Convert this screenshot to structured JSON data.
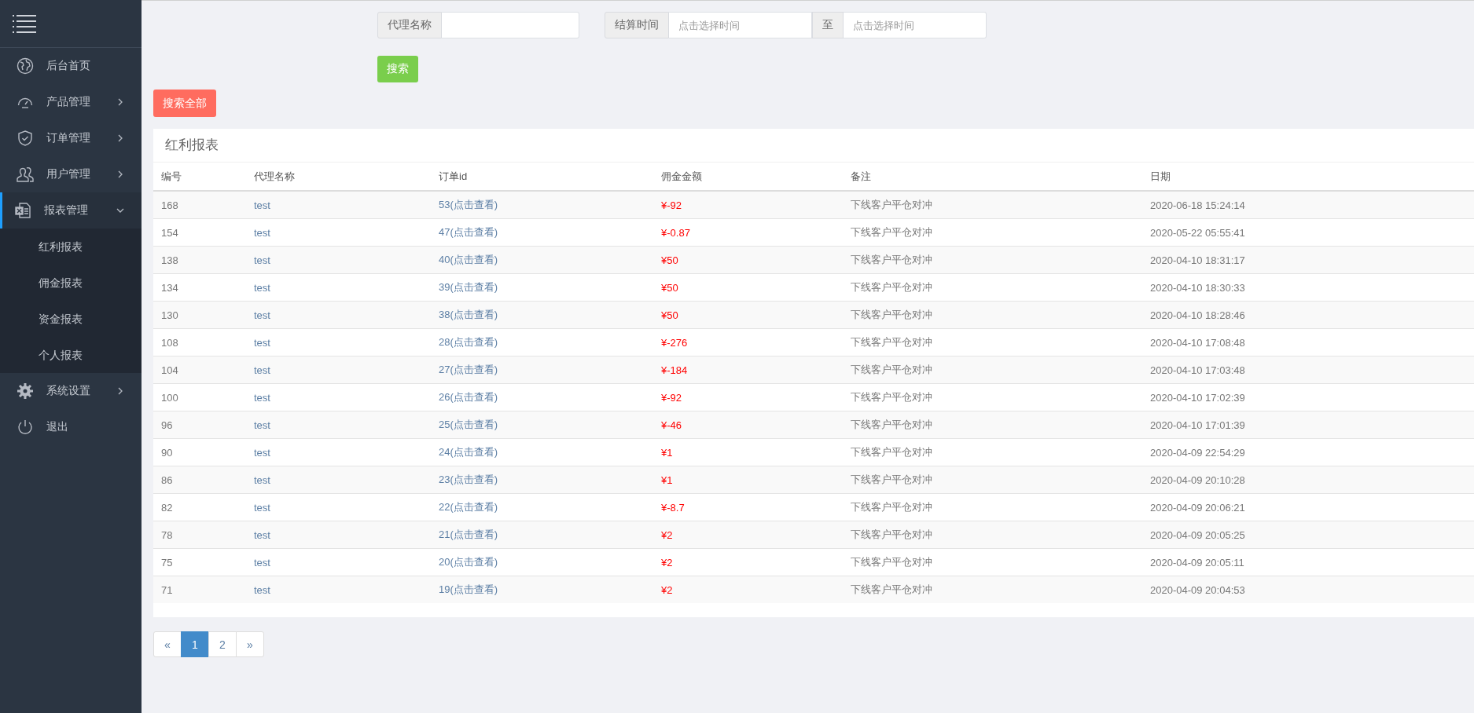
{
  "sidebar": {
    "items": [
      {
        "label": "后台首页"
      },
      {
        "label": "产品管理",
        "expanded": false
      },
      {
        "label": "订单管理",
        "expanded": false
      },
      {
        "label": "用户管理",
        "expanded": false
      },
      {
        "label": "报表管理",
        "expanded": true,
        "children": [
          {
            "label": "红利报表"
          },
          {
            "label": "佣金报表"
          },
          {
            "label": "资金报表"
          },
          {
            "label": "个人报表"
          }
        ]
      },
      {
        "label": "系统设置",
        "expanded": false
      },
      {
        "label": "退出"
      }
    ]
  },
  "search": {
    "agent_label": "代理名称",
    "time_label": "结算时间",
    "time_from_placeholder": "点击选择时间",
    "separator": "至",
    "time_to_placeholder": "点击选择时间",
    "search_button": "搜索",
    "search_all_button": "搜索全部"
  },
  "table": {
    "title": "红利报表",
    "columns": [
      "编号",
      "代理名称",
      "订单id",
      "佣金金额",
      "备注",
      "日期"
    ],
    "rows": [
      [
        "168",
        "test",
        "53(点击查看)",
        "¥-92",
        "下线客户平仓对冲",
        "2020-06-18 15:24:14"
      ],
      [
        "154",
        "test",
        "47(点击查看)",
        "¥-0.87",
        "下线客户平仓对冲",
        "2020-05-22 05:55:41"
      ],
      [
        "138",
        "test",
        "40(点击查看)",
        "¥50",
        "下线客户平仓对冲",
        "2020-04-10 18:31:17"
      ],
      [
        "134",
        "test",
        "39(点击查看)",
        "¥50",
        "下线客户平仓对冲",
        "2020-04-10 18:30:33"
      ],
      [
        "130",
        "test",
        "38(点击查看)",
        "¥50",
        "下线客户平仓对冲",
        "2020-04-10 18:28:46"
      ],
      [
        "108",
        "test",
        "28(点击查看)",
        "¥-276",
        "下线客户平仓对冲",
        "2020-04-10 17:08:48"
      ],
      [
        "104",
        "test",
        "27(点击查看)",
        "¥-184",
        "下线客户平仓对冲",
        "2020-04-10 17:03:48"
      ],
      [
        "100",
        "test",
        "26(点击查看)",
        "¥-92",
        "下线客户平仓对冲",
        "2020-04-10 17:02:39"
      ],
      [
        "96",
        "test",
        "25(点击查看)",
        "¥-46",
        "下线客户平仓对冲",
        "2020-04-10 17:01:39"
      ],
      [
        "90",
        "test",
        "24(点击查看)",
        "¥1",
        "下线客户平仓对冲",
        "2020-04-09 22:54:29"
      ],
      [
        "86",
        "test",
        "23(点击查看)",
        "¥1",
        "下线客户平仓对冲",
        "2020-04-09 20:10:28"
      ],
      [
        "82",
        "test",
        "22(点击查看)",
        "¥-8.7",
        "下线客户平仓对冲",
        "2020-04-09 20:06:21"
      ],
      [
        "78",
        "test",
        "21(点击查看)",
        "¥2",
        "下线客户平仓对冲",
        "2020-04-09 20:05:25"
      ],
      [
        "75",
        "test",
        "20(点击查看)",
        "¥2",
        "下线客户平仓对冲",
        "2020-04-09 20:05:11"
      ],
      [
        "71",
        "test",
        "19(点击查看)",
        "¥2",
        "下线客户平仓对冲",
        "2020-04-09 20:04:53"
      ]
    ]
  },
  "pagination": [
    {
      "label": "«",
      "selected": false
    },
    {
      "label": "1",
      "selected": true
    },
    {
      "label": "2",
      "selected": false
    },
    {
      "label": "»",
      "selected": false
    }
  ]
}
